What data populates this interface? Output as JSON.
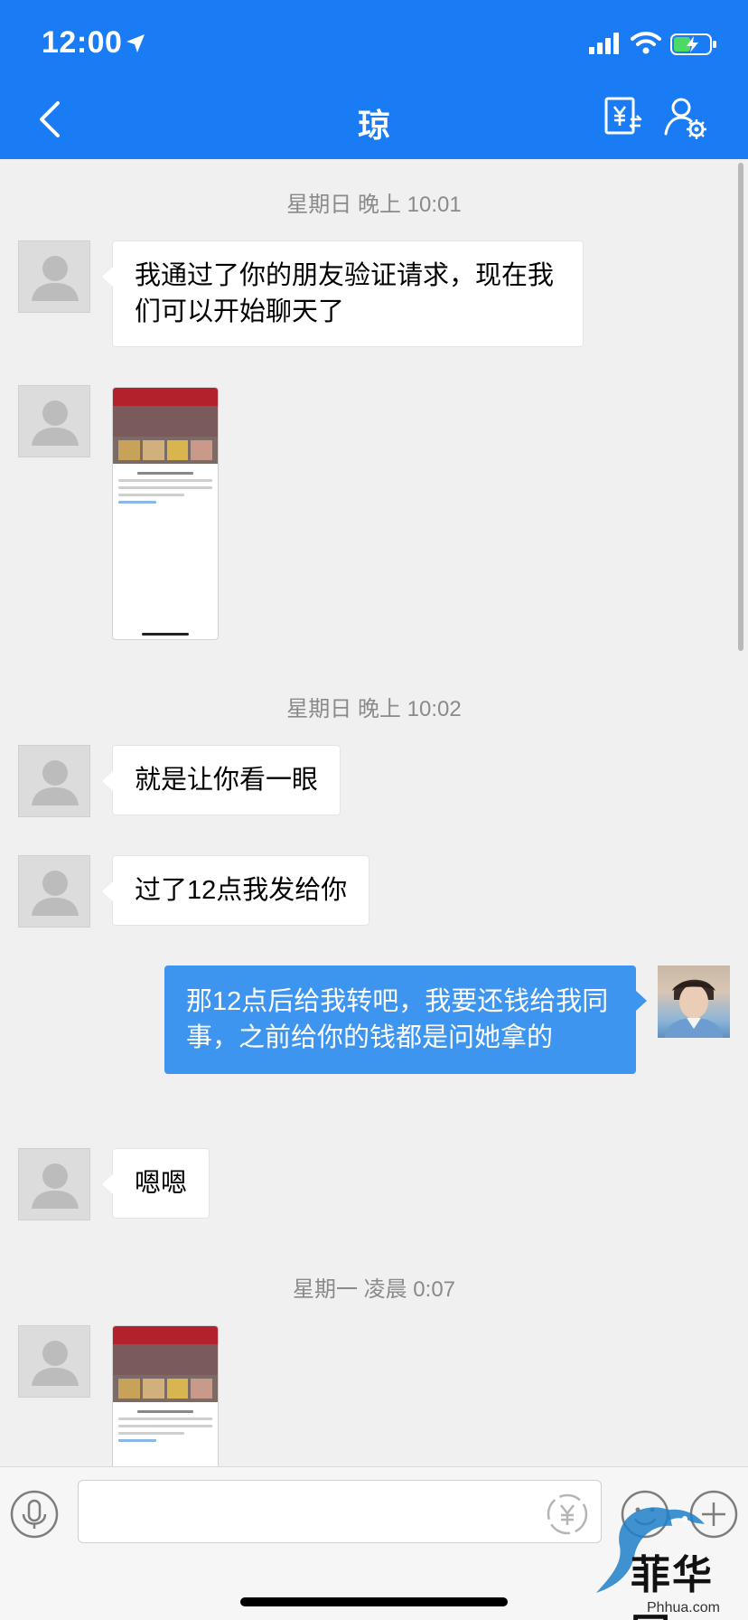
{
  "status_bar": {
    "time": "12:00",
    "icons": [
      "location-arrow-icon",
      "signal-icon",
      "wifi-icon",
      "battery-charging-icon"
    ]
  },
  "header": {
    "title": "琼",
    "background": "#1a7cf5",
    "icons": [
      "back-icon",
      "transfer-yuan-icon",
      "user-settings-icon"
    ]
  },
  "messages": [
    {
      "type": "timestamp",
      "text": "星期日 晚上 10:01"
    },
    {
      "type": "text",
      "direction": "in",
      "text": "我通过了你的朋友验证请求，现在我们可以开始聊天了"
    },
    {
      "type": "image",
      "direction": "in",
      "content": "screenshot-thumbnail"
    },
    {
      "type": "timestamp",
      "text": "星期日 晚上 10:02"
    },
    {
      "type": "text",
      "direction": "in",
      "text": "就是让你看一眼"
    },
    {
      "type": "text",
      "direction": "in",
      "text": "过了12点我发给你"
    },
    {
      "type": "text",
      "direction": "out",
      "text": "那12点后给我转吧，我要还钱给我同事，之前给你的钱都是问她拿的"
    },
    {
      "type": "text",
      "direction": "in",
      "text": "嗯嗯"
    },
    {
      "type": "timestamp",
      "text": "星期一 凌晨 0:07"
    },
    {
      "type": "image",
      "direction": "in",
      "content": "screenshot-thumbnail"
    }
  ],
  "input_bar": {
    "message_value": "",
    "icons": [
      "microphone-icon",
      "red-packet-icon",
      "emoji-icon",
      "plus-icon"
    ]
  },
  "watermark": {
    "title": "菲华网",
    "url": "Phhua.com"
  },
  "colors": {
    "outgoing_bubble": "#3d95f0",
    "incoming_bubble": "#ffffff",
    "chat_background": "#f0f0f0"
  }
}
